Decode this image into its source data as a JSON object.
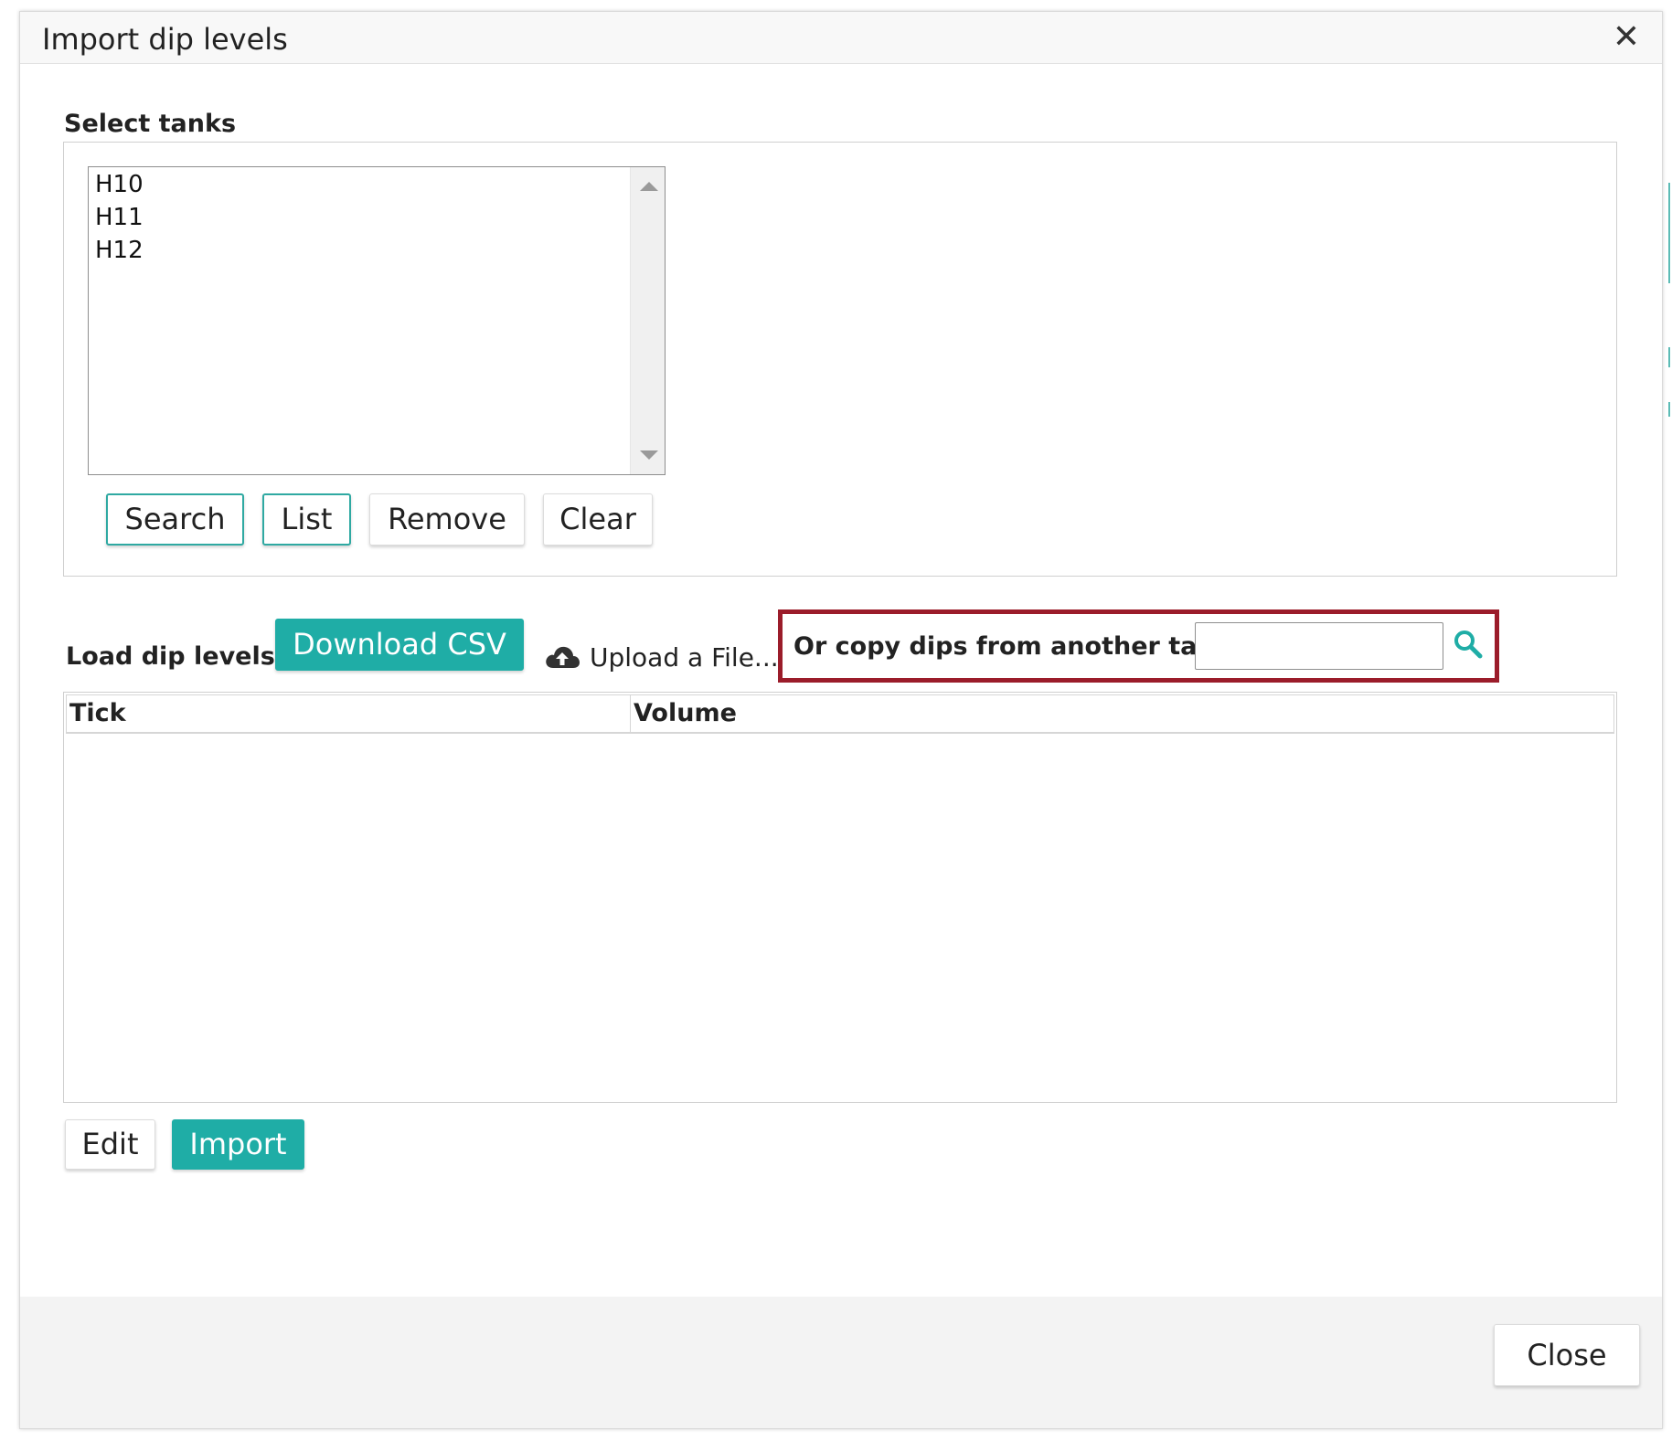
{
  "dialog": {
    "title": "Import dip levels",
    "close_icon": "close-icon"
  },
  "select_tanks": {
    "label": "Select tanks",
    "items": [
      "H10",
      "H11",
      "H12"
    ],
    "buttons": {
      "search": "Search",
      "list": "List",
      "remove": "Remove",
      "clear": "Clear"
    }
  },
  "load": {
    "label": "Load dip levels:",
    "download_csv": "Download CSV",
    "upload_icon": "cloud-upload-icon",
    "upload": "Upload a File...",
    "copy_label": "Or copy dips from another tank",
    "copy_value": "",
    "search_icon": "search-icon"
  },
  "grid": {
    "columns": [
      "Tick",
      "Volume"
    ],
    "rows": []
  },
  "actions": {
    "edit": "Edit",
    "import": "Import"
  },
  "footer": {
    "close": "Close"
  },
  "colors": {
    "accent": "#1fada6",
    "highlight": "#9b1c2a"
  }
}
